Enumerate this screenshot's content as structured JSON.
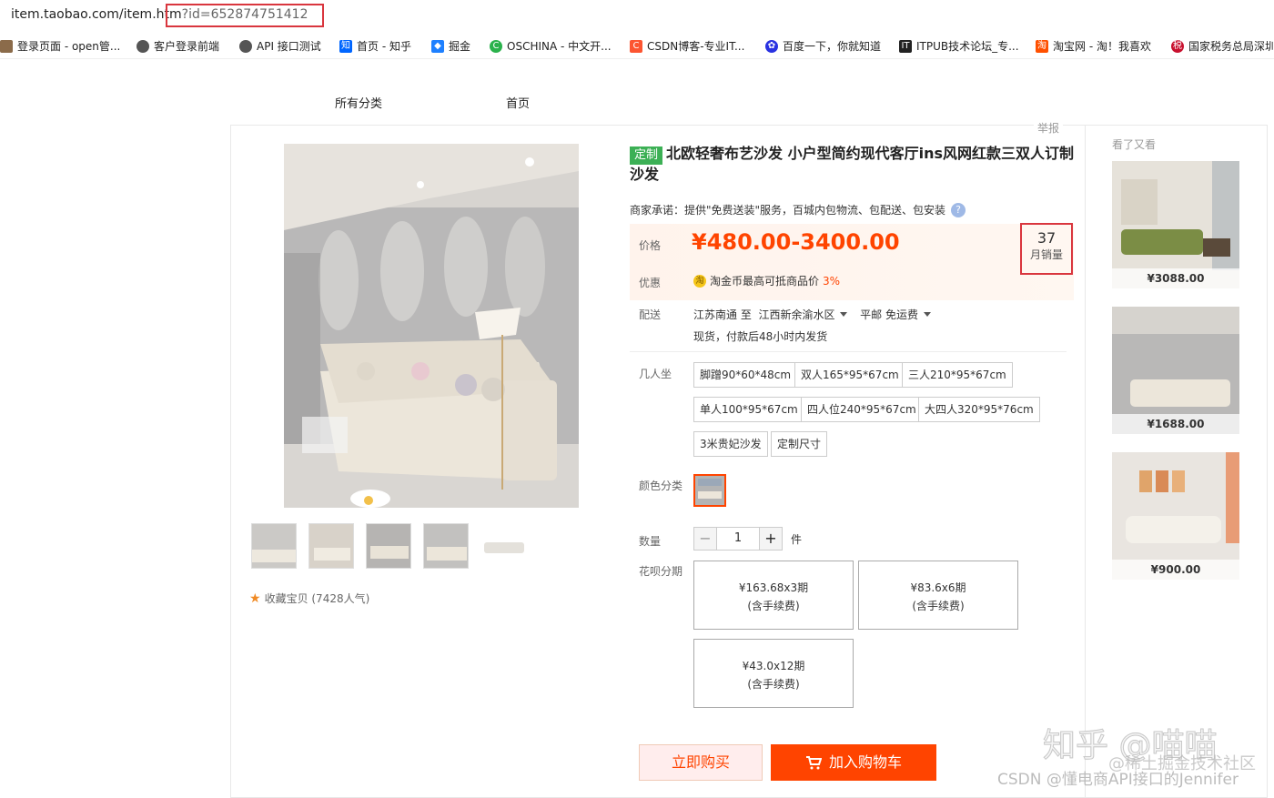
{
  "browser": {
    "url_prefix": "item.taobao.com/item.htm",
    "url_query": "?id=652874751412",
    "bookmarks": [
      {
        "label": "登录页面 - open管...",
        "icon": "page-icon"
      },
      {
        "label": "客户登录前端",
        "icon": "globe-icon"
      },
      {
        "label": "API 接口测试",
        "icon": "globe-icon"
      },
      {
        "label": "首页 - 知乎",
        "icon": "zhihu-icon"
      },
      {
        "label": "掘金",
        "icon": "juejin-icon"
      },
      {
        "label": "OSCHINA - 中文开...",
        "icon": "oschina-icon"
      },
      {
        "label": "CSDN博客-专业IT...",
        "icon": "csdn-icon"
      },
      {
        "label": "百度一下，你就知道",
        "icon": "baidu-icon"
      },
      {
        "label": "ITPUB技术论坛_专...",
        "icon": "itpub-icon"
      },
      {
        "label": "淘宝网 - 淘！我喜欢",
        "icon": "taobao-icon"
      },
      {
        "label": "国家税务总局深圳",
        "icon": "tax-icon"
      }
    ]
  },
  "nav": {
    "all_categories": "所有分类",
    "home": "首页"
  },
  "report": "举报",
  "product": {
    "tag": "定制",
    "title": "北欧轻奢布艺沙发 小户型简约现代客厅ins风网红款三双人订制沙发",
    "promise": "商家承诺：提供\"免费送装\"服务，百城内包物流、包配送、包安装",
    "price_label": "价格",
    "price": "¥480.00-3400.00",
    "monthly_sales": "37",
    "monthly_sales_label": "月销量",
    "promo_label": "优惠",
    "promo_coin": "淘",
    "promo_text": "淘金币最高可抵商品价",
    "promo_percent": "3%",
    "delivery_label": "配送",
    "delivery_from": "江苏南通 至",
    "delivery_to": "江西新余渝水区",
    "delivery_fee": "平邮 免运费",
    "delivery_note": "现货，付款后48小时内发货",
    "size_label": "几人坐",
    "sizes": [
      "脚蹭90*60*48cm",
      "双人165*95*67cm",
      "三人210*95*67cm",
      "单人100*95*67cm",
      "四人位240*95*67cm",
      "大四人320*95*76cm",
      "3米贵妃沙发",
      "定制尺寸"
    ],
    "color_label": "颜色分类",
    "qty_label": "数量",
    "qty_value": "1",
    "qty_unit": "件",
    "qty_minus": "−",
    "qty_plus": "+",
    "installment_label": "花呗分期",
    "installments": [
      {
        "amount": "¥163.68x3期",
        "note": "(含手续费)"
      },
      {
        "amount": "¥83.6x6期",
        "note": "(含手续费)"
      },
      {
        "amount": "¥43.0x12期",
        "note": "(含手续费)"
      }
    ],
    "buy_now": "立即购买",
    "add_to_cart": "加入购物车",
    "favorite": "收藏宝贝 (7428人气)"
  },
  "recommend": {
    "title": "看了又看",
    "items": [
      {
        "price": "¥3088.00"
      },
      {
        "price": "¥1688.00"
      },
      {
        "price": "¥900.00"
      }
    ]
  },
  "watermarks": {
    "zhihu": "知乎 @喵喵",
    "juejin": "@稀土掘金技术社区",
    "csdn": "CSDN @懂电商API接口的Jennifer"
  },
  "colors": {
    "price": "#ff4400",
    "highlight_box": "#d9363e",
    "custom_tag": "#3cb055"
  }
}
